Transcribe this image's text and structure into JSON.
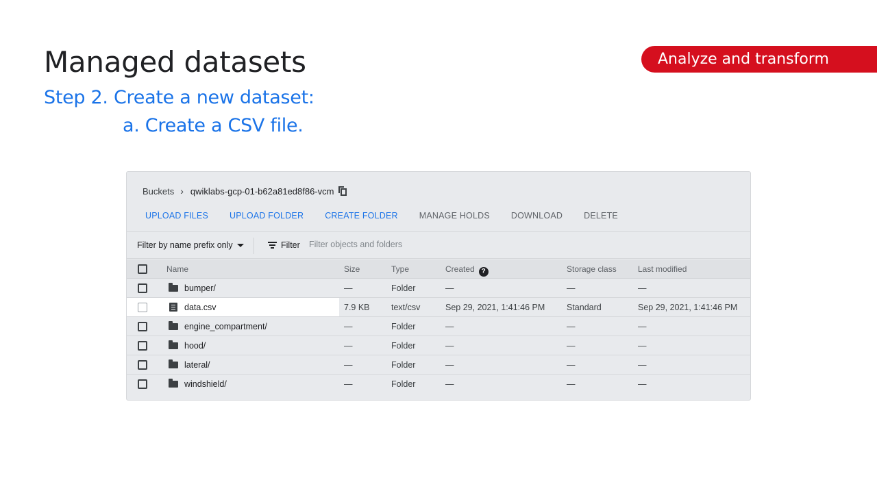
{
  "slide": {
    "title": "Managed datasets",
    "step": "Step 2. Create a new dataset:",
    "substep": "a. Create a CSV file.",
    "badge": "Analyze and transform"
  },
  "colors": {
    "accent_blue": "#1a73e8",
    "badge_red": "#d50f1e",
    "panel_bg": "#e8eaed"
  },
  "breadcrumb": {
    "root": "Buckets",
    "separator_icon": "chevron-right-icon",
    "bucket": "qwiklabs-gcp-01-b62a81ed8f86-vcm",
    "copy_icon": "copy-icon"
  },
  "toolbar": {
    "upload_files": "UPLOAD FILES",
    "upload_folder": "UPLOAD FOLDER",
    "create_folder": "CREATE FOLDER",
    "manage_holds": "MANAGE HOLDS",
    "download": "DOWNLOAD",
    "delete": "DELETE"
  },
  "filter": {
    "mode": "Filter by name prefix only",
    "button": "Filter",
    "placeholder": "Filter objects and folders"
  },
  "table": {
    "columns": {
      "name": "Name",
      "size": "Size",
      "type": "Type",
      "created": "Created",
      "storage_class": "Storage class",
      "last_modified": "Last modified"
    },
    "rows": [
      {
        "name": "bumper/",
        "icon": "folder-icon",
        "size": "—",
        "type": "Folder",
        "created": "—",
        "storage_class": "—",
        "last_modified": "—"
      },
      {
        "name": "data.csv",
        "icon": "file-icon",
        "size": "7.9 KB",
        "type": "text/csv",
        "created": "Sep 29, 2021, 1:41:46 PM",
        "storage_class": "Standard",
        "last_modified": "Sep 29, 2021, 1:41:46 PM"
      },
      {
        "name": "engine_compartment/",
        "icon": "folder-icon",
        "size": "—",
        "type": "Folder",
        "created": "—",
        "storage_class": "—",
        "last_modified": "—"
      },
      {
        "name": "hood/",
        "icon": "folder-icon",
        "size": "—",
        "type": "Folder",
        "created": "—",
        "storage_class": "—",
        "last_modified": "—"
      },
      {
        "name": "lateral/",
        "icon": "folder-icon",
        "size": "—",
        "type": "Folder",
        "created": "—",
        "storage_class": "—",
        "last_modified": "—"
      },
      {
        "name": "windshield/",
        "icon": "folder-icon",
        "size": "—",
        "type": "Folder",
        "created": "—",
        "storage_class": "—",
        "last_modified": "—"
      }
    ]
  }
}
